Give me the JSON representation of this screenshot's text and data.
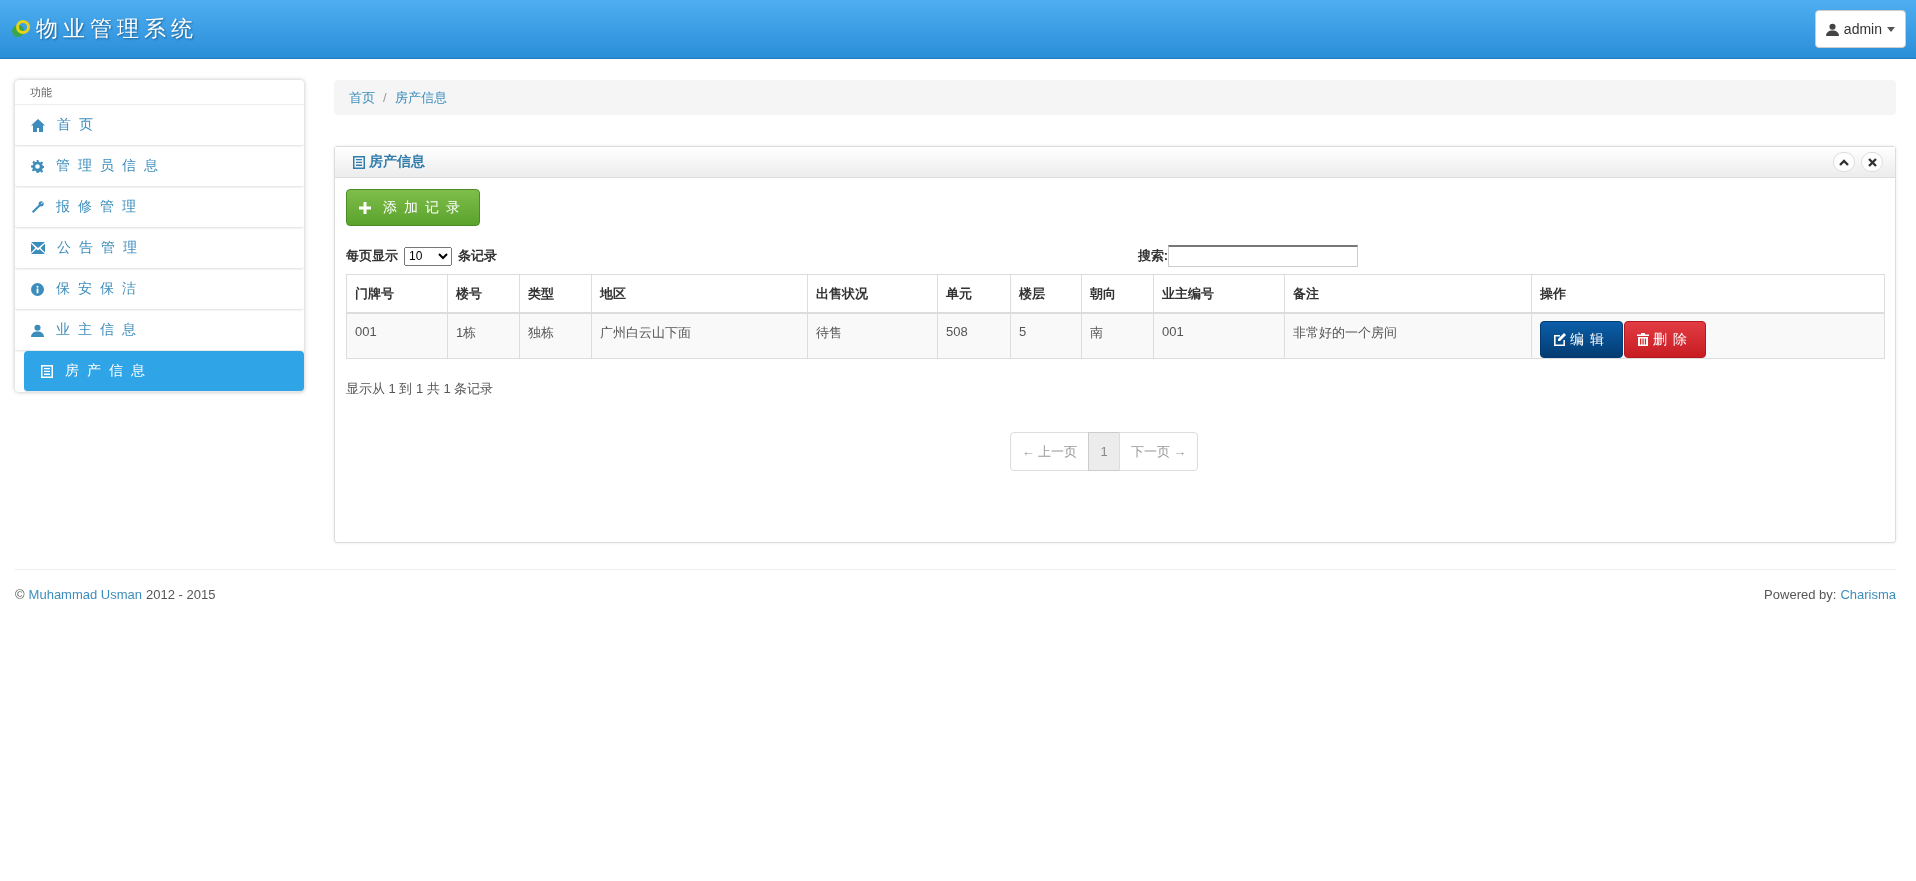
{
  "header": {
    "brand": "物业管理系统",
    "user_menu": "admin"
  },
  "sidebar": {
    "heading": "功能",
    "items": [
      {
        "label": "首页",
        "selected": false
      },
      {
        "label": "管理员信息",
        "selected": false
      },
      {
        "label": "报修管理",
        "selected": false
      },
      {
        "label": "公告管理",
        "selected": false
      },
      {
        "label": "保安保洁",
        "selected": false
      },
      {
        "label": "业主信息",
        "selected": false
      },
      {
        "label": "房产信息",
        "selected": true
      }
    ]
  },
  "breadcrumb": {
    "links": [
      "首页",
      "房产信息"
    ],
    "separator": "/"
  },
  "panel": {
    "title": "房产信息",
    "add_button": "添加记录",
    "page_size": {
      "prefix": "每页显示",
      "value": "10",
      "suffix": "条记录"
    },
    "search": {
      "label": "搜索:"
    },
    "table": {
      "columns": [
        "门牌号",
        "楼号",
        "类型",
        "地区",
        "出售状况",
        "单元",
        "楼层",
        "朝向",
        "业主编号",
        "备注",
        "操作"
      ],
      "rows": [
        {
          "cells": [
            "001",
            "1栋",
            "独栋",
            "广州白云山下面",
            "待售",
            "508",
            "5",
            "南",
            "001",
            "非常好的一个房间"
          ],
          "actions": [
            "编辑",
            "删除"
          ]
        }
      ]
    },
    "summary": "显示从 1 到 1 共 1 条记录",
    "pagination": [
      {
        "label": "← 上一页",
        "selected": false,
        "disabled": true
      },
      {
        "label": "1",
        "selected": true,
        "disabled": false
      },
      {
        "label": "下一页 →",
        "selected": false,
        "disabled": true
      }
    ]
  },
  "footer": {
    "copyright": "©",
    "author": "Muhammad Usman",
    "years": "2012 - 2015",
    "powered_label": "Powered by:",
    "powered_link": "Charisma"
  }
}
